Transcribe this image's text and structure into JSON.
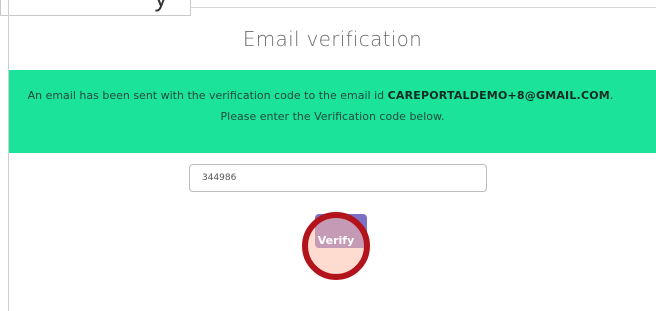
{
  "tab": {
    "label": "y"
  },
  "page_title": "Email verification",
  "banner": {
    "message_prefix": "An email has been sent with the verification code to the email id ",
    "email": "CAREPORTALDEMO+8@GMAIL.COM",
    "message_suffix": ".",
    "instruction": "Please enter the Verification code below."
  },
  "verification": {
    "code_value": "344986",
    "verify_label": "Verify"
  },
  "colors": {
    "banner_bg": "#1be39a",
    "button_bg": "#7d6fc4",
    "click_ring": "#b3131b"
  }
}
